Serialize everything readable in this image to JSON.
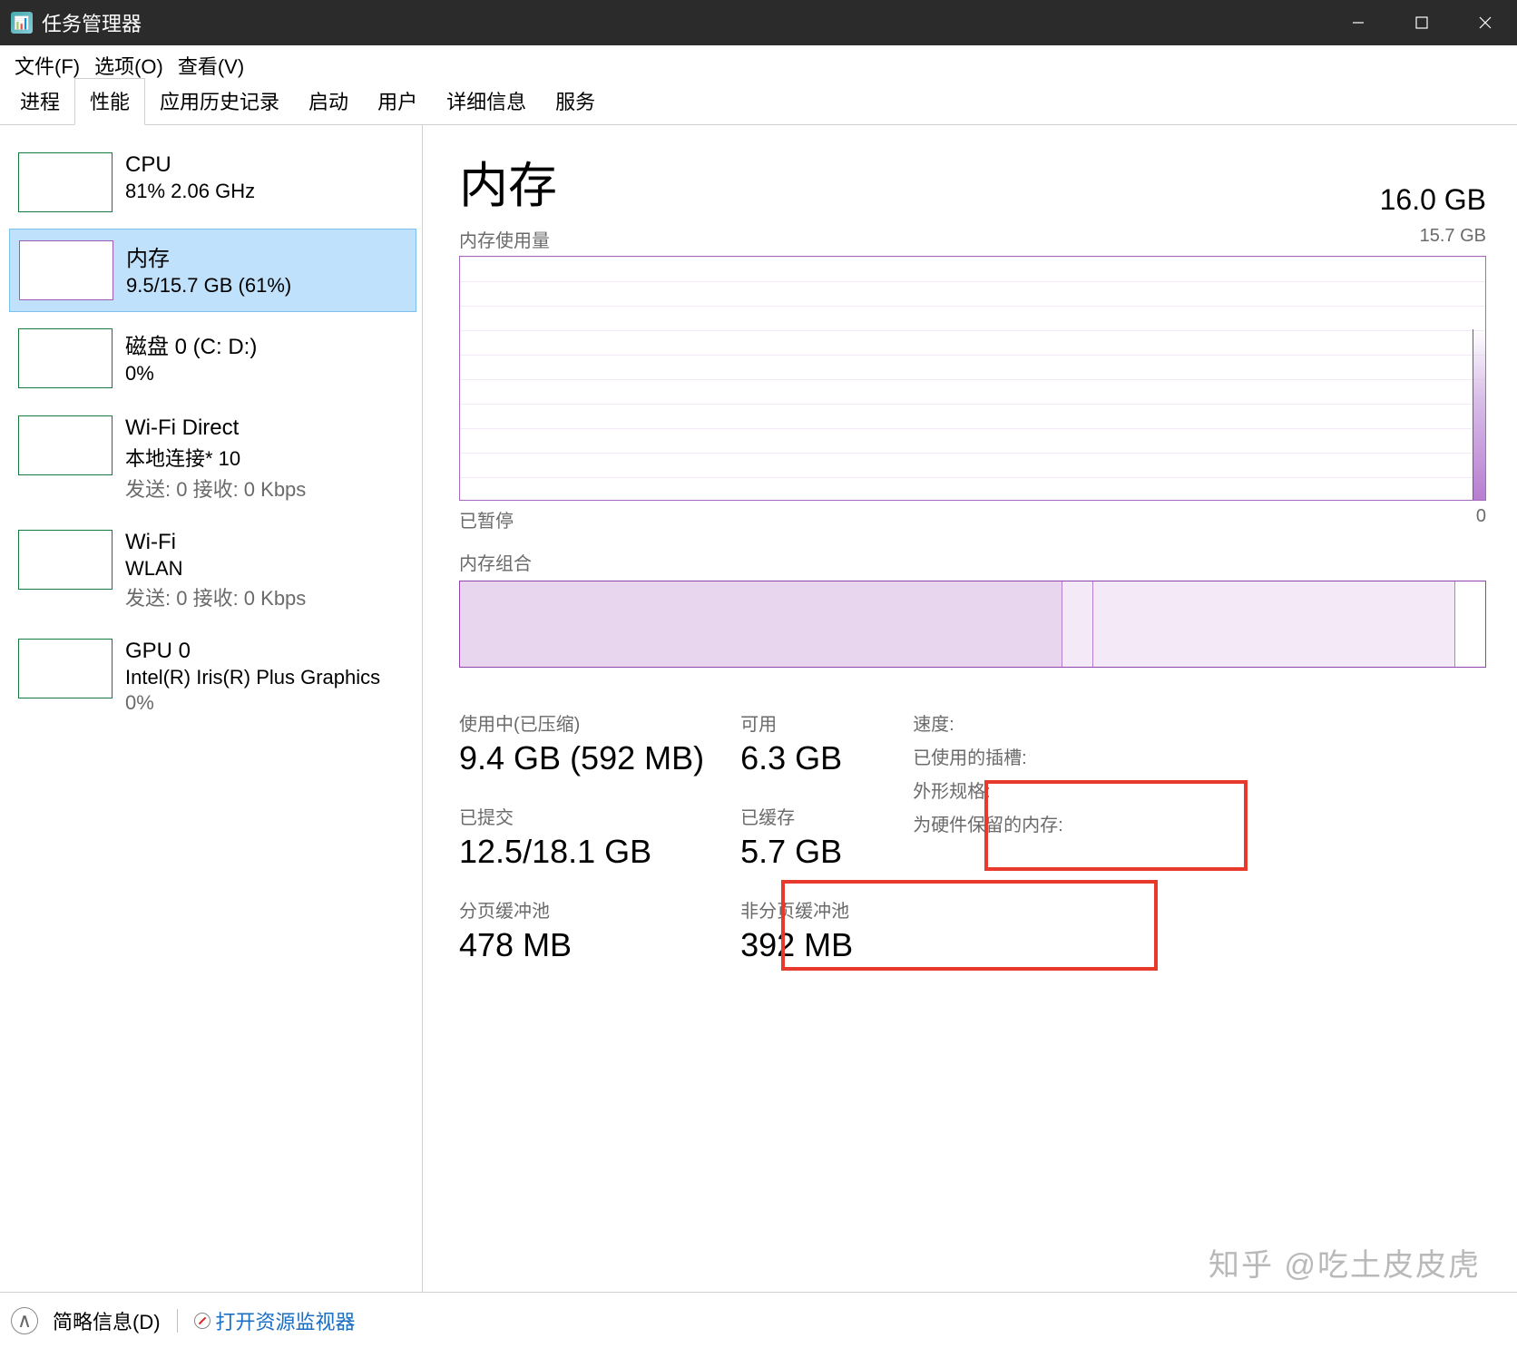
{
  "window": {
    "title": "任务管理器"
  },
  "menu": {
    "file": "文件(F)",
    "options": "选项(O)",
    "view": "查看(V)"
  },
  "tabs": [
    "进程",
    "性能",
    "应用历史记录",
    "启动",
    "用户",
    "详细信息",
    "服务"
  ],
  "active_tab_index": 1,
  "sidebar": [
    {
      "name": "CPU",
      "sub": "81% 2.06 GHz"
    },
    {
      "name": "内存",
      "sub": "9.5/15.7 GB (61%)"
    },
    {
      "name": "磁盘 0 (C: D:)",
      "sub": "0%"
    },
    {
      "name": "Wi-Fi Direct",
      "sub": "本地连接* 10",
      "sub2": "发送: 0 接收: 0 Kbps"
    },
    {
      "name": "Wi-Fi",
      "sub": "WLAN",
      "sub2": "发送: 0 接收: 0 Kbps"
    },
    {
      "name": "GPU 0",
      "sub": "Intel(R) Iris(R) Plus Graphics",
      "sub2": "0%"
    }
  ],
  "detail": {
    "title": "内存",
    "total": "16.0 GB",
    "graph_label_left": "内存使用量",
    "graph_label_right": "15.7 GB",
    "sub_label_left": "已暂停",
    "sub_label_right": "0",
    "composition_label": "内存组合",
    "stats": {
      "in_use_label": "使用中(已压缩)",
      "in_use_value": "9.4 GB (592 MB)",
      "available_label": "可用",
      "available_value": "6.3 GB",
      "committed_label": "已提交",
      "committed_value": "12.5/18.1 GB",
      "cached_label": "已缓存",
      "cached_value": "5.7 GB",
      "paged_label": "分页缓冲池",
      "paged_value": "478 MB",
      "nonpaged_label": "非分页缓冲池",
      "nonpaged_value": "392 MB"
    },
    "right_labels": [
      "速度:",
      "已使用的插槽:",
      "外形规格:",
      "为硬件保留的内存:"
    ]
  },
  "footer": {
    "simple": "简略信息(D)",
    "resource_monitor": "打开资源监视器"
  },
  "watermark": "知乎 @吃土皮皮虎",
  "chart_data": {
    "type": "line",
    "title": "内存使用量",
    "ylabel": "GB",
    "ylim": [
      0,
      15.7
    ],
    "note": "历史曲线近 0 ，最右端出现向上尖峰至约 10 GB"
  }
}
